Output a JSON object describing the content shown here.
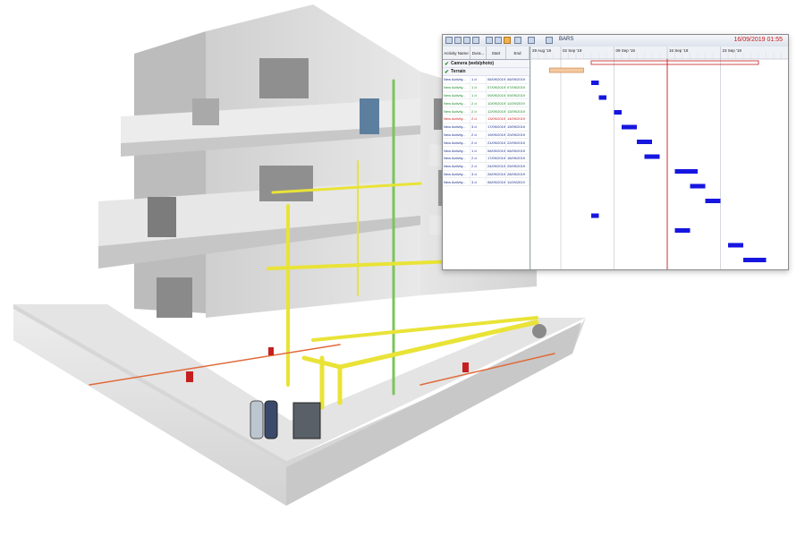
{
  "gantt": {
    "datetime": "16/09/2019 01:55",
    "view_label": "BARS",
    "columns": [
      "Activity Name",
      "Dura...",
      "Start",
      "End"
    ],
    "week_labels": [
      "29 Aug '19",
      "02 Sep '19",
      "09 Sep '19",
      "16 Sep '19",
      "23 Sep '19"
    ],
    "groups": [
      "Camera (web/photo)",
      "Terrain"
    ],
    "rows": [
      {
        "name": "New Activity...",
        "dur": "1 d",
        "start": "06/09/2019",
        "end": "06/09/2019",
        "status": "blue"
      },
      {
        "name": "New Activity...",
        "dur": "1 d",
        "start": "07/09/2019",
        "end": "07/09/2019",
        "status": "green"
      },
      {
        "name": "New Activity...",
        "dur": "1 d",
        "start": "09/09/2019",
        "end": "09/09/2019",
        "status": "green"
      },
      {
        "name": "New Activity...",
        "dur": "2 d",
        "start": "10/09/2019",
        "end": "11/09/2019",
        "status": "green"
      },
      {
        "name": "New Activity...",
        "dur": "2 d",
        "start": "12/09/2019",
        "end": "13/09/2019",
        "status": "green"
      },
      {
        "name": "New Activity...",
        "dur": "2 d",
        "start": "13/09/2019",
        "end": "14/09/2019",
        "status": "red"
      },
      {
        "name": "New Activity...",
        "dur": "3 d",
        "start": "17/09/2019",
        "end": "19/09/2019",
        "status": "blue"
      },
      {
        "name": "New Activity...",
        "dur": "2 d",
        "start": "19/09/2019",
        "end": "20/09/2019",
        "status": "blue"
      },
      {
        "name": "New Activity...",
        "dur": "2 d",
        "start": "21/09/2019",
        "end": "22/09/2019",
        "status": "blue"
      },
      {
        "name": "New Activity...",
        "dur": "1 d",
        "start": "06/09/2019",
        "end": "06/09/2019",
        "status": "blue"
      },
      {
        "name": "New Activity...",
        "dur": "2 d",
        "start": "17/09/2019",
        "end": "18/09/2019",
        "status": "blue"
      },
      {
        "name": "New Activity...",
        "dur": "2 d",
        "start": "24/09/2019",
        "end": "25/09/2019",
        "status": "blue"
      },
      {
        "name": "New Activity...",
        "dur": "3 d",
        "start": "26/09/2019",
        "end": "28/09/2019",
        "status": "blue"
      },
      {
        "name": "New Activity...",
        "dur": "3 d",
        "start": "06/09/2019",
        "end": "11/09/2019",
        "status": "blue"
      }
    ]
  },
  "scene_colors": {
    "wall": "#dcdcdc",
    "wall_dark": "#bdbdbd",
    "pipe_yellow": "#e9e337",
    "pipe_green": "#7cc45a",
    "pipe_red": "#e06a3a",
    "gantt_bar": "#1616e0",
    "today_line": "#c22020"
  }
}
